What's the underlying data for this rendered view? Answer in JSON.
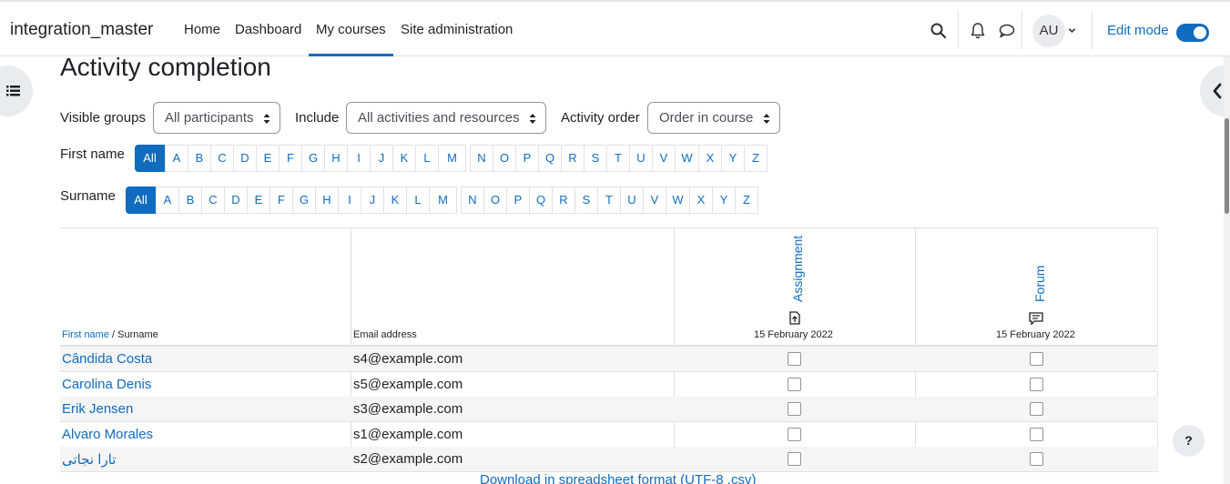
{
  "site": {
    "name": "integration_master"
  },
  "nav": [
    {
      "label": "Home"
    },
    {
      "label": "Dashboard"
    },
    {
      "label": "My courses"
    },
    {
      "label": "Site administration"
    }
  ],
  "user": {
    "initials": "AU"
  },
  "edit_mode": {
    "label": "Edit mode",
    "enabled": true
  },
  "page": {
    "title": "Activity completion"
  },
  "filters": {
    "groups": {
      "label": "Visible groups",
      "value": "All participants"
    },
    "include": {
      "label": "Include",
      "value": "All activities and resources"
    },
    "order": {
      "label": "Activity order",
      "value": "Order in course"
    }
  },
  "initials_bars": {
    "first_name": {
      "label": "First name",
      "all": "All"
    },
    "surname": {
      "label": "Surname",
      "all": "All"
    },
    "letters": [
      "A",
      "B",
      "C",
      "D",
      "E",
      "F",
      "G",
      "H",
      "I",
      "J",
      "K",
      "L",
      "M",
      "N",
      "O",
      "P",
      "Q",
      "R",
      "S",
      "T",
      "U",
      "V",
      "W",
      "X",
      "Y",
      "Z"
    ]
  },
  "table": {
    "header": {
      "first_name": "First name",
      "sep": " / ",
      "surname": "Surname",
      "email": "Email address"
    },
    "activities": [
      {
        "name": "Assignment",
        "icon": "assignment-icon",
        "date": "15 February 2022"
      },
      {
        "name": "Forum",
        "icon": "forum-icon",
        "date": "15 February 2022"
      }
    ],
    "rows": [
      {
        "name": "Cândida Costa",
        "email": "s4@example.com",
        "completion": [
          false,
          false
        ]
      },
      {
        "name": "Carolina Denis",
        "email": "s5@example.com",
        "completion": [
          false,
          false
        ]
      },
      {
        "name": "Erik Jensen",
        "email": "s3@example.com",
        "completion": [
          false,
          false
        ]
      },
      {
        "name": "Alvaro Morales",
        "email": "s1@example.com",
        "completion": [
          false,
          false
        ]
      },
      {
        "name": "تارا نجاتی",
        "email": "s2@example.com",
        "completion": [
          false,
          false
        ]
      }
    ]
  },
  "download": {
    "label": "Download in spreadsheet format (UTF-8 .csv)"
  },
  "help": {
    "label": "?"
  },
  "colors": {
    "primary": "#0f6cbf",
    "text": "#1d2125",
    "border": "#dee2e6"
  }
}
